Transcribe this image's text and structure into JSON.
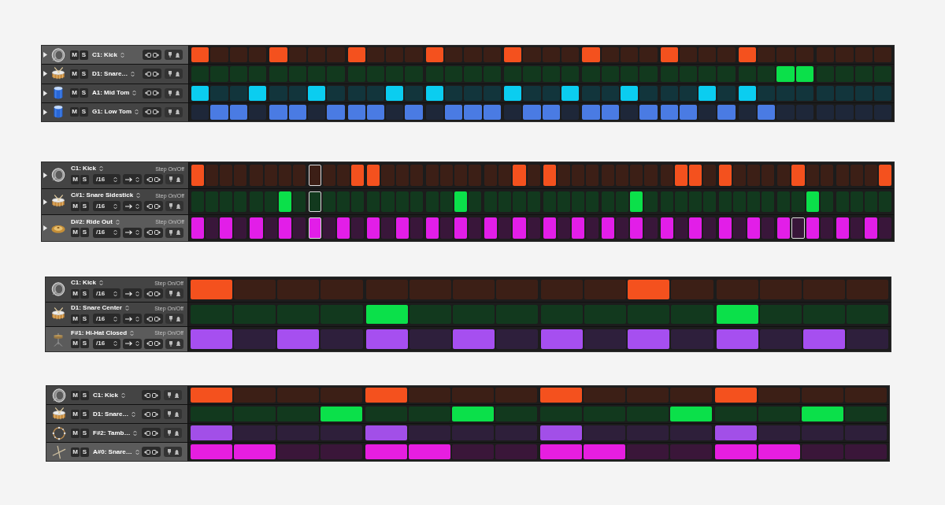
{
  "panels": [
    {
      "kind": "compact",
      "disclosure": true,
      "rows": [
        {
          "kind": "kick",
          "mute_button": "M",
          "solo_button": "S",
          "name": "C1: Kick",
          "selected": true,
          "color": "#f4511e",
          "steps": [
            {
              "on": true
            },
            {
              "on": false
            },
            {
              "on": false
            },
            {
              "on": false
            },
            {
              "on": true
            },
            {
              "on": false
            },
            {
              "on": false
            },
            {
              "on": false
            },
            {
              "on": true
            },
            {
              "on": false
            },
            {
              "on": false
            },
            {
              "on": false
            },
            {
              "on": true
            },
            {
              "on": false
            },
            {
              "on": false
            },
            {
              "on": false
            },
            {
              "on": true
            },
            {
              "on": false
            },
            {
              "on": false
            },
            {
              "on": false
            },
            {
              "on": true
            },
            {
              "on": false
            },
            {
              "on": false
            },
            {
              "on": false
            },
            {
              "on": true
            },
            {
              "on": false
            },
            {
              "on": false
            },
            {
              "on": false
            },
            {
              "on": true
            },
            {
              "on": false
            },
            {
              "on": false
            },
            {
              "on": false
            },
            {
              "on": false
            },
            {
              "on": false
            },
            {
              "on": false
            },
            {
              "on": false
            }
          ]
        },
        {
          "kind": "snare",
          "mute_button": "M",
          "solo_button": "S",
          "name": "D1: Snare…",
          "selected": false,
          "color": "#0be04a",
          "steps": [
            {
              "on": false
            },
            {
              "on": false
            },
            {
              "on": false
            },
            {
              "on": false
            },
            {
              "on": false
            },
            {
              "on": false
            },
            {
              "on": false
            },
            {
              "on": false
            },
            {
              "on": false
            },
            {
              "on": false
            },
            {
              "on": false
            },
            {
              "on": false
            },
            {
              "on": false
            },
            {
              "on": false
            },
            {
              "on": false
            },
            {
              "on": false
            },
            {
              "on": false
            },
            {
              "on": false
            },
            {
              "on": false
            },
            {
              "on": false
            },
            {
              "on": false
            },
            {
              "on": false
            },
            {
              "on": false
            },
            {
              "on": false
            },
            {
              "on": false
            },
            {
              "on": false
            },
            {
              "on": false
            },
            {
              "on": false
            },
            {
              "on": false
            },
            {
              "on": false
            },
            {
              "on": true
            },
            {
              "on": true
            },
            {
              "on": false
            },
            {
              "on": false
            },
            {
              "on": false
            },
            {
              "on": false
            }
          ]
        },
        {
          "kind": "tom",
          "mute_button": "M",
          "solo_button": "S",
          "name": "A1: Mid Tom",
          "selected": false,
          "color": "#0bcdf0",
          "steps": [
            {
              "on": true
            },
            {
              "on": false
            },
            {
              "on": false
            },
            {
              "on": true
            },
            {
              "on": false
            },
            {
              "on": false
            },
            {
              "on": true
            },
            {
              "on": false
            },
            {
              "on": false
            },
            {
              "on": false
            },
            {
              "on": true
            },
            {
              "on": false
            },
            {
              "on": true
            },
            {
              "on": false
            },
            {
              "on": false
            },
            {
              "on": false
            },
            {
              "on": true
            },
            {
              "on": false
            },
            {
              "on": false
            },
            {
              "on": true
            },
            {
              "on": false
            },
            {
              "on": false
            },
            {
              "on": true
            },
            {
              "on": false
            },
            {
              "on": false
            },
            {
              "on": false
            },
            {
              "on": true
            },
            {
              "on": false
            },
            {
              "on": true
            },
            {
              "on": false
            },
            {
              "on": false
            },
            {
              "on": false
            },
            {
              "on": false
            },
            {
              "on": false
            },
            {
              "on": false
            },
            {
              "on": false
            }
          ]
        },
        {
          "kind": "tom",
          "mute_button": "M",
          "solo_button": "S",
          "name": "G1: Low Tom",
          "selected": false,
          "color": "#4a7be3",
          "steps": [
            {
              "on": false
            },
            {
              "on": true
            },
            {
              "on": true
            },
            {
              "on": false
            },
            {
              "on": true
            },
            {
              "on": true
            },
            {
              "on": false
            },
            {
              "on": true
            },
            {
              "on": true
            },
            {
              "on": true
            },
            {
              "on": false
            },
            {
              "on": true
            },
            {
              "on": false
            },
            {
              "on": true
            },
            {
              "on": true
            },
            {
              "on": true
            },
            {
              "on": false
            },
            {
              "on": true
            },
            {
              "on": true
            },
            {
              "on": false
            },
            {
              "on": true
            },
            {
              "on": true
            },
            {
              "on": false
            },
            {
              "on": true
            },
            {
              "on": true
            },
            {
              "on": true
            },
            {
              "on": false
            },
            {
              "on": true
            },
            {
              "on": false
            },
            {
              "on": true
            },
            {
              "on": false
            },
            {
              "on": false
            },
            {
              "on": false
            },
            {
              "on": false
            },
            {
              "on": false
            },
            {
              "on": false
            }
          ]
        }
      ]
    },
    {
      "kind": "expanded",
      "disclosure": true,
      "rows": [
        {
          "kind": "kick",
          "name": "C1: Kick",
          "mode": "Step On/Off",
          "mute_button": "M",
          "solo_button": "S",
          "rate": "/16",
          "selected": false,
          "color": "#f4511e",
          "steps": [
            {
              "on": true,
              "cursor": false
            },
            {
              "on": false,
              "cursor": false
            },
            {
              "on": false,
              "cursor": false
            },
            {
              "on": false,
              "cursor": false
            },
            {
              "on": false,
              "cursor": false
            },
            {
              "on": false,
              "cursor": false
            },
            {
              "on": false,
              "cursor": false
            },
            {
              "on": false,
              "cursor": false
            },
            {
              "on": false,
              "cursor": true
            },
            {
              "on": false,
              "cursor": false
            },
            {
              "on": false,
              "cursor": false
            },
            {
              "on": true,
              "cursor": false
            },
            {
              "on": true,
              "cursor": false
            },
            {
              "on": false,
              "cursor": false
            },
            {
              "on": false,
              "cursor": false
            },
            {
              "on": false,
              "cursor": false
            },
            {
              "on": false,
              "cursor": false
            },
            {
              "on": false,
              "cursor": false
            },
            {
              "on": false,
              "cursor": false
            },
            {
              "on": false,
              "cursor": false
            },
            {
              "on": false,
              "cursor": false
            },
            {
              "on": false,
              "cursor": false
            },
            {
              "on": true,
              "cursor": false
            },
            {
              "on": false,
              "cursor": false
            },
            {
              "on": true,
              "cursor": false
            },
            {
              "on": false,
              "cursor": false
            },
            {
              "on": false,
              "cursor": false
            },
            {
              "on": false,
              "cursor": false
            },
            {
              "on": false,
              "cursor": false
            },
            {
              "on": false,
              "cursor": false
            },
            {
              "on": false,
              "cursor": false
            },
            {
              "on": false,
              "cursor": false
            },
            {
              "on": false,
              "cursor": false
            },
            {
              "on": true,
              "cursor": false
            },
            {
              "on": true,
              "cursor": false
            },
            {
              "on": false,
              "cursor": false
            },
            {
              "on": true,
              "cursor": false
            },
            {
              "on": false,
              "cursor": false
            },
            {
              "on": false,
              "cursor": false
            },
            {
              "on": false,
              "cursor": false
            },
            {
              "on": false,
              "cursor": false
            },
            {
              "on": true,
              "cursor": false
            },
            {
              "on": false,
              "cursor": false
            },
            {
              "on": false,
              "cursor": false
            },
            {
              "on": false,
              "cursor": false
            },
            {
              "on": false,
              "cursor": false
            },
            {
              "on": false,
              "cursor": false
            },
            {
              "on": true,
              "cursor": false
            }
          ]
        },
        {
          "kind": "snare",
          "name": "C#1: Snare Sidestick",
          "mode": "Step On/Off",
          "mute_button": "M",
          "solo_button": "S",
          "rate": "/16",
          "selected": false,
          "color": "#0be04a",
          "steps": [
            {
              "on": false,
              "cursor": false
            },
            {
              "on": false,
              "cursor": false
            },
            {
              "on": false,
              "cursor": false
            },
            {
              "on": false,
              "cursor": false
            },
            {
              "on": false,
              "cursor": false
            },
            {
              "on": false,
              "cursor": false
            },
            {
              "on": true,
              "cursor": false
            },
            {
              "on": false,
              "cursor": false
            },
            {
              "on": false,
              "cursor": true
            },
            {
              "on": false,
              "cursor": false
            },
            {
              "on": false,
              "cursor": false
            },
            {
              "on": false,
              "cursor": false
            },
            {
              "on": false,
              "cursor": false
            },
            {
              "on": false,
              "cursor": false
            },
            {
              "on": false,
              "cursor": false
            },
            {
              "on": false,
              "cursor": false
            },
            {
              "on": false,
              "cursor": false
            },
            {
              "on": false,
              "cursor": false
            },
            {
              "on": true,
              "cursor": false
            },
            {
              "on": false,
              "cursor": false
            },
            {
              "on": false,
              "cursor": false
            },
            {
              "on": false,
              "cursor": false
            },
            {
              "on": false,
              "cursor": false
            },
            {
              "on": false,
              "cursor": false
            },
            {
              "on": false,
              "cursor": false
            },
            {
              "on": false,
              "cursor": false
            },
            {
              "on": false,
              "cursor": false
            },
            {
              "on": false,
              "cursor": false
            },
            {
              "on": false,
              "cursor": false
            },
            {
              "on": false,
              "cursor": false
            },
            {
              "on": true,
              "cursor": false
            },
            {
              "on": false,
              "cursor": false
            },
            {
              "on": false,
              "cursor": false
            },
            {
              "on": false,
              "cursor": false
            },
            {
              "on": false,
              "cursor": false
            },
            {
              "on": false,
              "cursor": false
            },
            {
              "on": false,
              "cursor": false
            },
            {
              "on": false,
              "cursor": false
            },
            {
              "on": false,
              "cursor": false
            },
            {
              "on": false,
              "cursor": false
            },
            {
              "on": false,
              "cursor": false
            },
            {
              "on": false,
              "cursor": false
            },
            {
              "on": true,
              "cursor": false
            },
            {
              "on": false,
              "cursor": false
            },
            {
              "on": false,
              "cursor": false
            },
            {
              "on": false,
              "cursor": false
            },
            {
              "on": false,
              "cursor": false
            },
            {
              "on": false,
              "cursor": false
            }
          ]
        },
        {
          "kind": "cymbal",
          "name": "D#2: Ride Out",
          "mode": "Step On/Off",
          "mute_button": "M",
          "solo_button": "S",
          "rate": "/16",
          "selected": true,
          "color": "#e21ee8",
          "steps": [
            {
              "on": true,
              "cursor": false
            },
            {
              "on": false,
              "cursor": false
            },
            {
              "on": true,
              "cursor": false
            },
            {
              "on": false,
              "cursor": false
            },
            {
              "on": true,
              "cursor": false
            },
            {
              "on": false,
              "cursor": false
            },
            {
              "on": true,
              "cursor": false
            },
            {
              "on": false,
              "cursor": false
            },
            {
              "on": true,
              "cursor": true
            },
            {
              "on": false,
              "cursor": false
            },
            {
              "on": true,
              "cursor": false
            },
            {
              "on": false,
              "cursor": false
            },
            {
              "on": true,
              "cursor": false
            },
            {
              "on": false,
              "cursor": false
            },
            {
              "on": true,
              "cursor": false
            },
            {
              "on": false,
              "cursor": false
            },
            {
              "on": true,
              "cursor": false
            },
            {
              "on": false,
              "cursor": false
            },
            {
              "on": true,
              "cursor": false
            },
            {
              "on": false,
              "cursor": false
            },
            {
              "on": true,
              "cursor": false
            },
            {
              "on": false,
              "cursor": false
            },
            {
              "on": true,
              "cursor": false
            },
            {
              "on": false,
              "cursor": false
            },
            {
              "on": true,
              "cursor": false
            },
            {
              "on": false,
              "cursor": false
            },
            {
              "on": true,
              "cursor": false
            },
            {
              "on": false,
              "cursor": false
            },
            {
              "on": true,
              "cursor": false
            },
            {
              "on": false,
              "cursor": false
            },
            {
              "on": true,
              "cursor": false
            },
            {
              "on": false,
              "cursor": false
            },
            {
              "on": true,
              "cursor": false
            },
            {
              "on": false,
              "cursor": false
            },
            {
              "on": true,
              "cursor": false
            },
            {
              "on": false,
              "cursor": false
            },
            {
              "on": true,
              "cursor": false
            },
            {
              "on": false,
              "cursor": false
            },
            {
              "on": true,
              "cursor": false
            },
            {
              "on": false,
              "cursor": false
            },
            {
              "on": true,
              "cursor": false
            },
            {
              "on": false,
              "cursor": true
            },
            {
              "on": true,
              "cursor": false
            },
            {
              "on": false,
              "cursor": false
            },
            {
              "on": true,
              "cursor": false
            },
            {
              "on": false,
              "cursor": false
            },
            {
              "on": true,
              "cursor": false
            },
            {
              "on": false,
              "cursor": false
            }
          ]
        }
      ]
    },
    {
      "kind": "expanded",
      "disclosure": false,
      "rows": [
        {
          "kind": "kick",
          "name": "C1: Kick",
          "mode": "Step On/Off",
          "mute_button": "M",
          "solo_button": "S",
          "rate": "/16",
          "selected": false,
          "color": "#f4511e",
          "steps": [
            {
              "on": true
            },
            {
              "on": false
            },
            {
              "on": false
            },
            {
              "on": false
            },
            {
              "on": false
            },
            {
              "on": false
            },
            {
              "on": false
            },
            {
              "on": false
            },
            {
              "on": false
            },
            {
              "on": false
            },
            {
              "on": true
            },
            {
              "on": false
            },
            {
              "on": false
            },
            {
              "on": false
            },
            {
              "on": false
            },
            {
              "on": false
            }
          ]
        },
        {
          "kind": "snare",
          "name": "D1: Snare Center",
          "mode": "Step On/Off",
          "mute_button": "M",
          "solo_button": "S",
          "rate": "/16",
          "selected": false,
          "color": "#0be04a",
          "steps": [
            {
              "on": false
            },
            {
              "on": false
            },
            {
              "on": false
            },
            {
              "on": false
            },
            {
              "on": true
            },
            {
              "on": false
            },
            {
              "on": false
            },
            {
              "on": false
            },
            {
              "on": false
            },
            {
              "on": false
            },
            {
              "on": false
            },
            {
              "on": false
            },
            {
              "on": true
            },
            {
              "on": false
            },
            {
              "on": false
            },
            {
              "on": false
            }
          ]
        },
        {
          "kind": "hihat",
          "name": "F#1: Hi-Hat Closed",
          "mode": "Step On/Off",
          "mute_button": "M",
          "solo_button": "S",
          "rate": "/16",
          "selected": true,
          "color": "#a64ff0",
          "steps": [
            {
              "on": true
            },
            {
              "on": false
            },
            {
              "on": true
            },
            {
              "on": false
            },
            {
              "on": true
            },
            {
              "on": false
            },
            {
              "on": true
            },
            {
              "on": false
            },
            {
              "on": true
            },
            {
              "on": false
            },
            {
              "on": true
            },
            {
              "on": false
            },
            {
              "on": true
            },
            {
              "on": false
            },
            {
              "on": true
            },
            {
              "on": false
            }
          ]
        }
      ]
    },
    {
      "kind": "compact",
      "disclosure": false,
      "rows": [
        {
          "kind": "kick",
          "mute_button": "M",
          "solo_button": "S",
          "name": "C1: Kick",
          "selected": false,
          "color": "#f4511e",
          "steps": [
            {
              "on": true
            },
            {
              "on": false
            },
            {
              "on": false
            },
            {
              "on": false
            },
            {
              "on": true
            },
            {
              "on": false
            },
            {
              "on": false
            },
            {
              "on": false
            },
            {
              "on": true
            },
            {
              "on": false
            },
            {
              "on": false
            },
            {
              "on": false
            },
            {
              "on": true
            },
            {
              "on": false
            },
            {
              "on": false
            },
            {
              "on": false
            }
          ]
        },
        {
          "kind": "snare",
          "mute_button": "M",
          "solo_button": "S",
          "name": "D1: Snare…",
          "selected": false,
          "color": "#0be04a",
          "steps": [
            {
              "on": false
            },
            {
              "on": false
            },
            {
              "on": false
            },
            {
              "on": true
            },
            {
              "on": false
            },
            {
              "on": false
            },
            {
              "on": true
            },
            {
              "on": false
            },
            {
              "on": false
            },
            {
              "on": false
            },
            {
              "on": false
            },
            {
              "on": true
            },
            {
              "on": false
            },
            {
              "on": false
            },
            {
              "on": true
            },
            {
              "on": false
            }
          ]
        },
        {
          "kind": "tambourine",
          "mute_button": "M",
          "solo_button": "S",
          "name": "F#2: Tamb…",
          "selected": false,
          "color": "#a24fe8",
          "steps": [
            {
              "on": true
            },
            {
              "on": false
            },
            {
              "on": false
            },
            {
              "on": false
            },
            {
              "on": true
            },
            {
              "on": false
            },
            {
              "on": false
            },
            {
              "on": false
            },
            {
              "on": true
            },
            {
              "on": false
            },
            {
              "on": false
            },
            {
              "on": false
            },
            {
              "on": true
            },
            {
              "on": false
            },
            {
              "on": false
            },
            {
              "on": false
            }
          ]
        },
        {
          "kind": "sticks",
          "mute_button": "M",
          "solo_button": "S",
          "name": "A#0: Snare…",
          "selected": true,
          "color": "#e61ee0",
          "steps": [
            {
              "on": true
            },
            {
              "on": true
            },
            {
              "on": false
            },
            {
              "on": false
            },
            {
              "on": true
            },
            {
              "on": true
            },
            {
              "on": false
            },
            {
              "on": false
            },
            {
              "on": true
            },
            {
              "on": true
            },
            {
              "on": false
            },
            {
              "on": false
            },
            {
              "on": true
            },
            {
              "on": true
            },
            {
              "on": false
            },
            {
              "on": false
            }
          ]
        }
      ]
    }
  ]
}
